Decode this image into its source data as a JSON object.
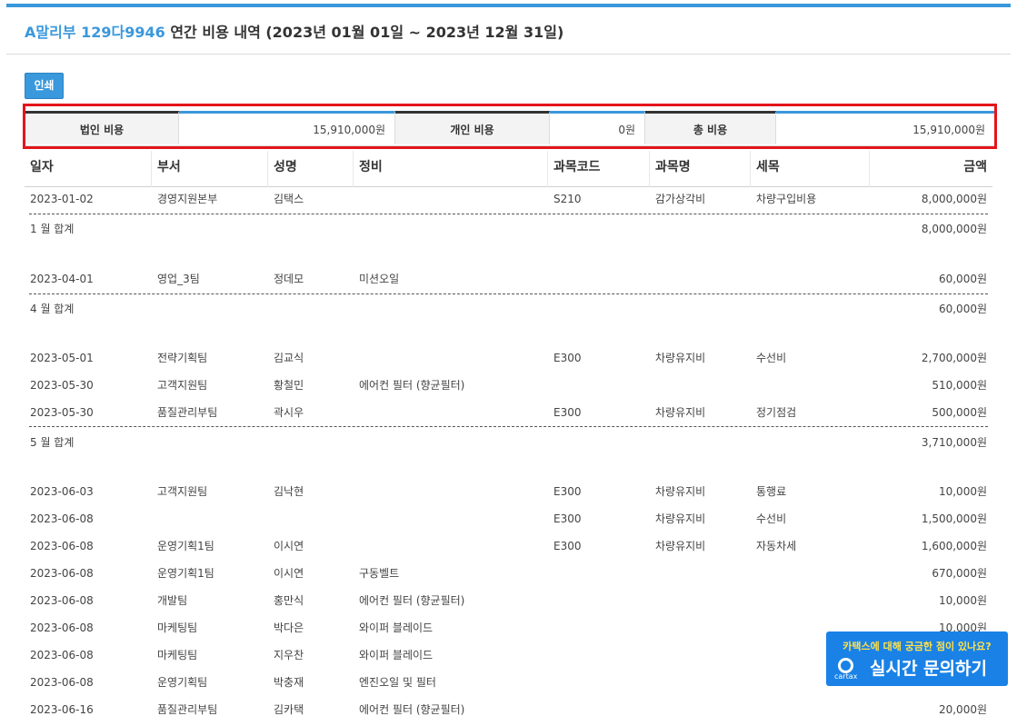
{
  "header": {
    "vehicle": "A말리부 129다9946",
    "title_rest": " 연간 비용 내역 (2023년 01월 01일 ~ 2023년 12월 31일)"
  },
  "toolbar": {
    "print_label": "인쇄"
  },
  "summary": {
    "corp_label": "법인 비용",
    "corp_value": "15,910,000원",
    "personal_label": "개인 비용",
    "personal_value": "0원",
    "total_label": "총 비용",
    "total_value": "15,910,000원"
  },
  "table": {
    "headers": [
      "일자",
      "부서",
      "성명",
      "정비",
      "과목코드",
      "과목명",
      "세목",
      "금액"
    ],
    "rows": [
      {
        "date": "2023-01-02",
        "dept": "경영지원본부",
        "name": "김택스",
        "repair": "",
        "code": "S210",
        "account": "감가상각비",
        "item": "차량구입비용",
        "amount": "8,000,000원"
      },
      {
        "date": "2023-04-01",
        "dept": "영업_3팀",
        "name": "정데모",
        "repair": "미션오일",
        "code": "",
        "account": "",
        "item": "",
        "amount": "60,000원"
      },
      {
        "date": "2023-05-01",
        "dept": "전략기획팀",
        "name": "김교식",
        "repair": "",
        "code": "E300",
        "account": "차량유지비",
        "item": "수선비",
        "amount": "2,700,000원"
      },
      {
        "date": "2023-05-30",
        "dept": "고객지원팀",
        "name": "황철민",
        "repair": "에어컨 필터 (향균필터)",
        "code": "",
        "account": "",
        "item": "",
        "amount": "510,000원"
      },
      {
        "date": "2023-05-30",
        "dept": "품질관리부팀",
        "name": "곽시우",
        "repair": "",
        "code": "E300",
        "account": "차량유지비",
        "item": "정기점검",
        "amount": "500,000원"
      },
      {
        "date": "2023-06-03",
        "dept": "고객지원팀",
        "name": "김낙현",
        "repair": "",
        "code": "E300",
        "account": "차량유지비",
        "item": "통행료",
        "amount": "10,000원"
      },
      {
        "date": "2023-06-08",
        "dept": "",
        "name": "",
        "repair": "",
        "code": "E300",
        "account": "차량유지비",
        "item": "수선비",
        "amount": "1,500,000원"
      },
      {
        "date": "2023-06-08",
        "dept": "운영기획1팀",
        "name": "이시연",
        "repair": "",
        "code": "E300",
        "account": "차량유지비",
        "item": "자동차세",
        "amount": "1,600,000원"
      },
      {
        "date": "2023-06-08",
        "dept": "운영기획1팀",
        "name": "이시연",
        "repair": "구동벨트",
        "code": "",
        "account": "",
        "item": "",
        "amount": "670,000원"
      },
      {
        "date": "2023-06-08",
        "dept": "개발팀",
        "name": "홍만식",
        "repair": "에어컨 필터 (향균필터)",
        "code": "",
        "account": "",
        "item": "",
        "amount": "10,000원"
      },
      {
        "date": "2023-06-08",
        "dept": "마케팅팀",
        "name": "박다은",
        "repair": "와이퍼 블레이드",
        "code": "",
        "account": "",
        "item": "",
        "amount": "10,000원"
      },
      {
        "date": "2023-06-08",
        "dept": "마케팅팀",
        "name": "지우찬",
        "repair": "와이퍼 블레이드",
        "code": "",
        "account": "",
        "item": "",
        "amount": ""
      },
      {
        "date": "2023-06-08",
        "dept": "운영기획팀",
        "name": "박충재",
        "repair": "엔진오일 및 필터",
        "code": "",
        "account": "",
        "item": "",
        "amount": ""
      },
      {
        "date": "2023-06-16",
        "dept": "품질관리부팀",
        "name": "김카택",
        "repair": "에어컨 필터 (향균필터)",
        "code": "",
        "account": "",
        "item": "",
        "amount": "20,000원"
      }
    ],
    "subtotals": [
      {
        "label": "1 월 합계",
        "amount": "8,000,000원"
      },
      {
        "label": "4 월 합계",
        "amount": "60,000원"
      },
      {
        "label": "5 월 합계",
        "amount": "3,710,000원"
      }
    ]
  },
  "chat_widget": {
    "question": "카택스에 대해 궁금한 점이 있나요?",
    "logo_text": "cartax",
    "cta": "실시간 문의하기"
  }
}
